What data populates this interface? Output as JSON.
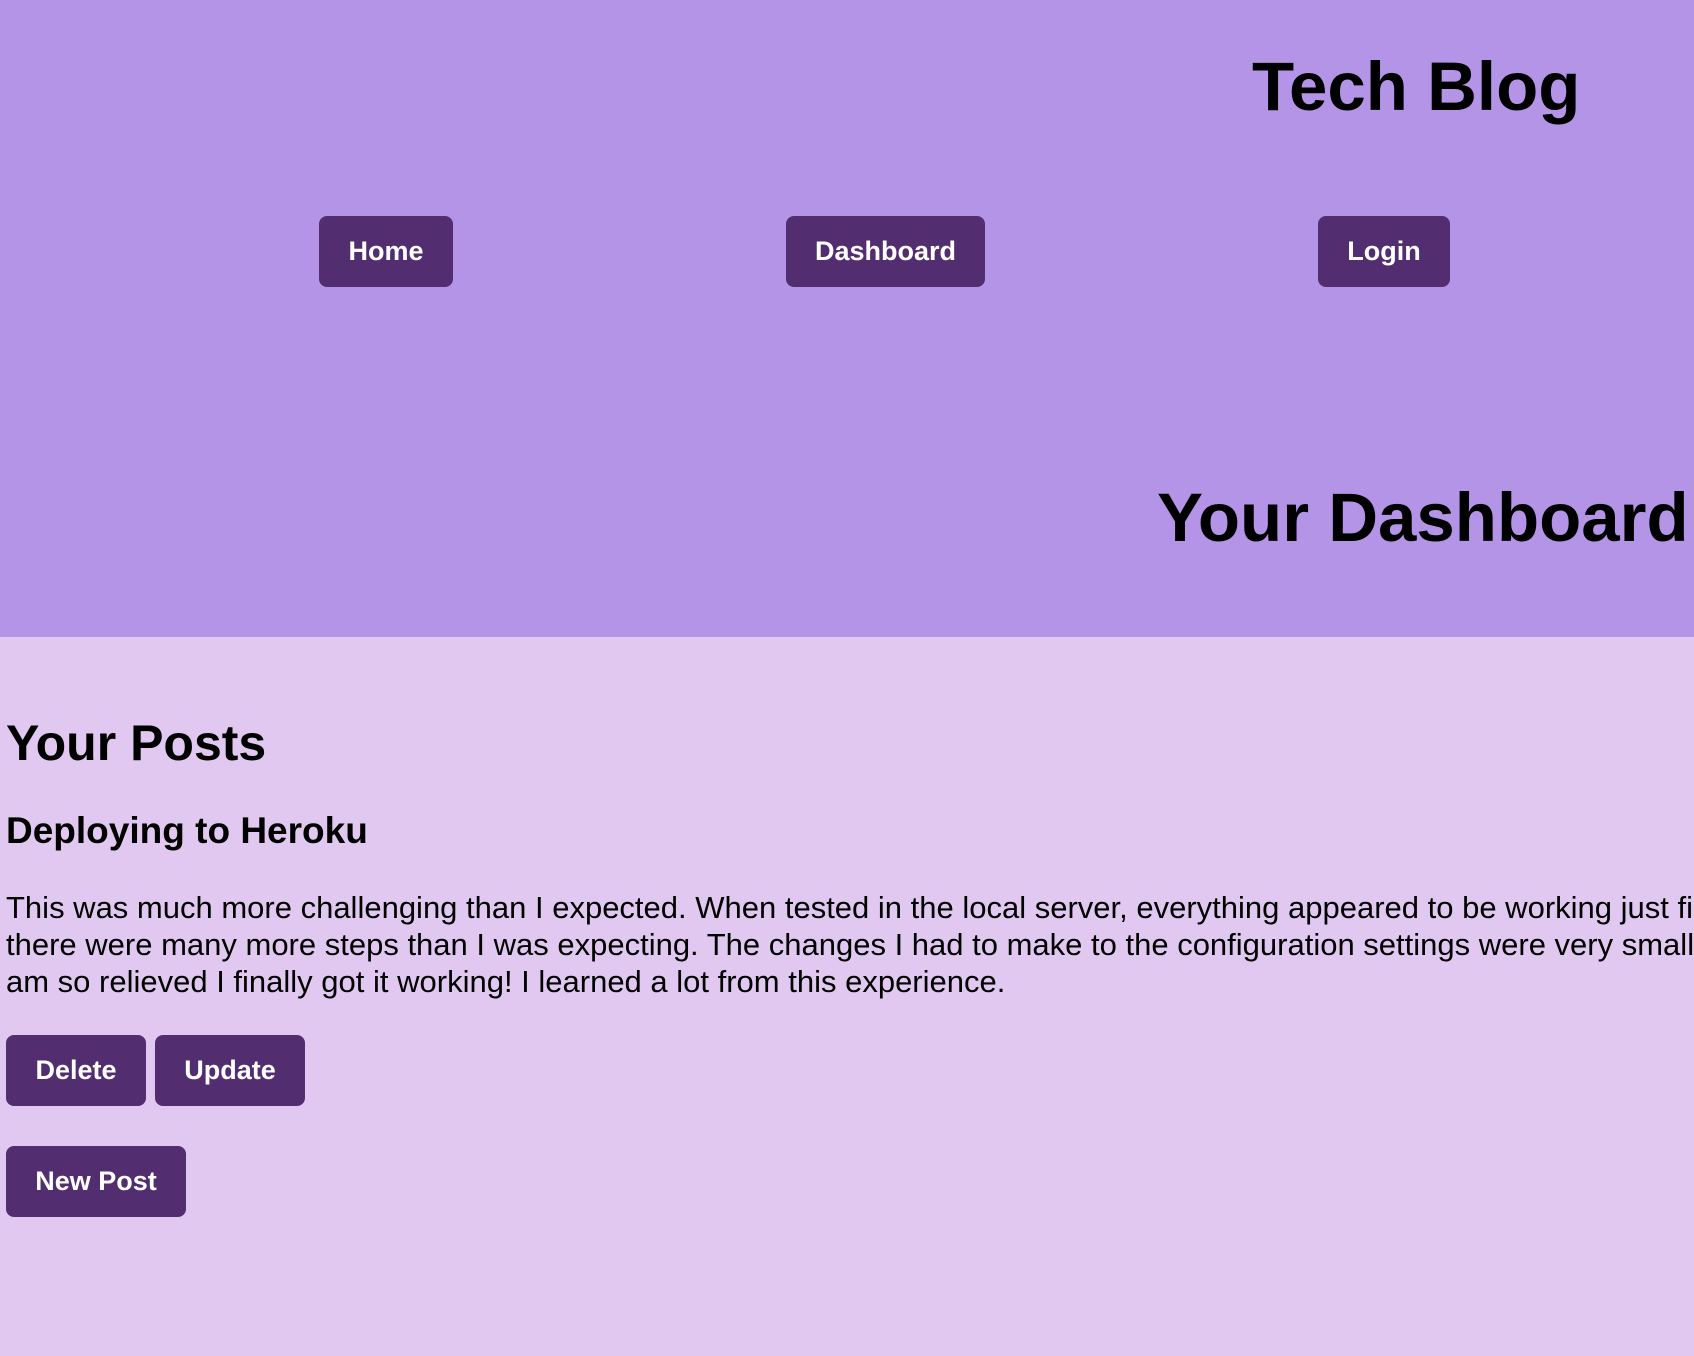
{
  "header": {
    "site_title": "Tech Blog",
    "nav": {
      "home": "Home",
      "dashboard": "Dashboard",
      "login": "Login"
    },
    "page_title": "Your Dashboard"
  },
  "main": {
    "section_title": "Your Posts",
    "post": {
      "title": "Deploying to Heroku",
      "body": "This was much more challenging than I expected. When tested in the local server, everything appeared to be working just fine, but there were many more steps than I was expecting. The changes I had to make to the configuration settings were very small, but I am so relieved I finally got it working! I learned a lot from this experience.",
      "delete_label": "Delete",
      "update_label": "Update"
    },
    "new_post_label": "New Post"
  },
  "colors": {
    "header_bg": "#b494e6",
    "page_bg": "#e1c8f0",
    "button_bg": "#522e70",
    "button_text": "#ffffff"
  }
}
